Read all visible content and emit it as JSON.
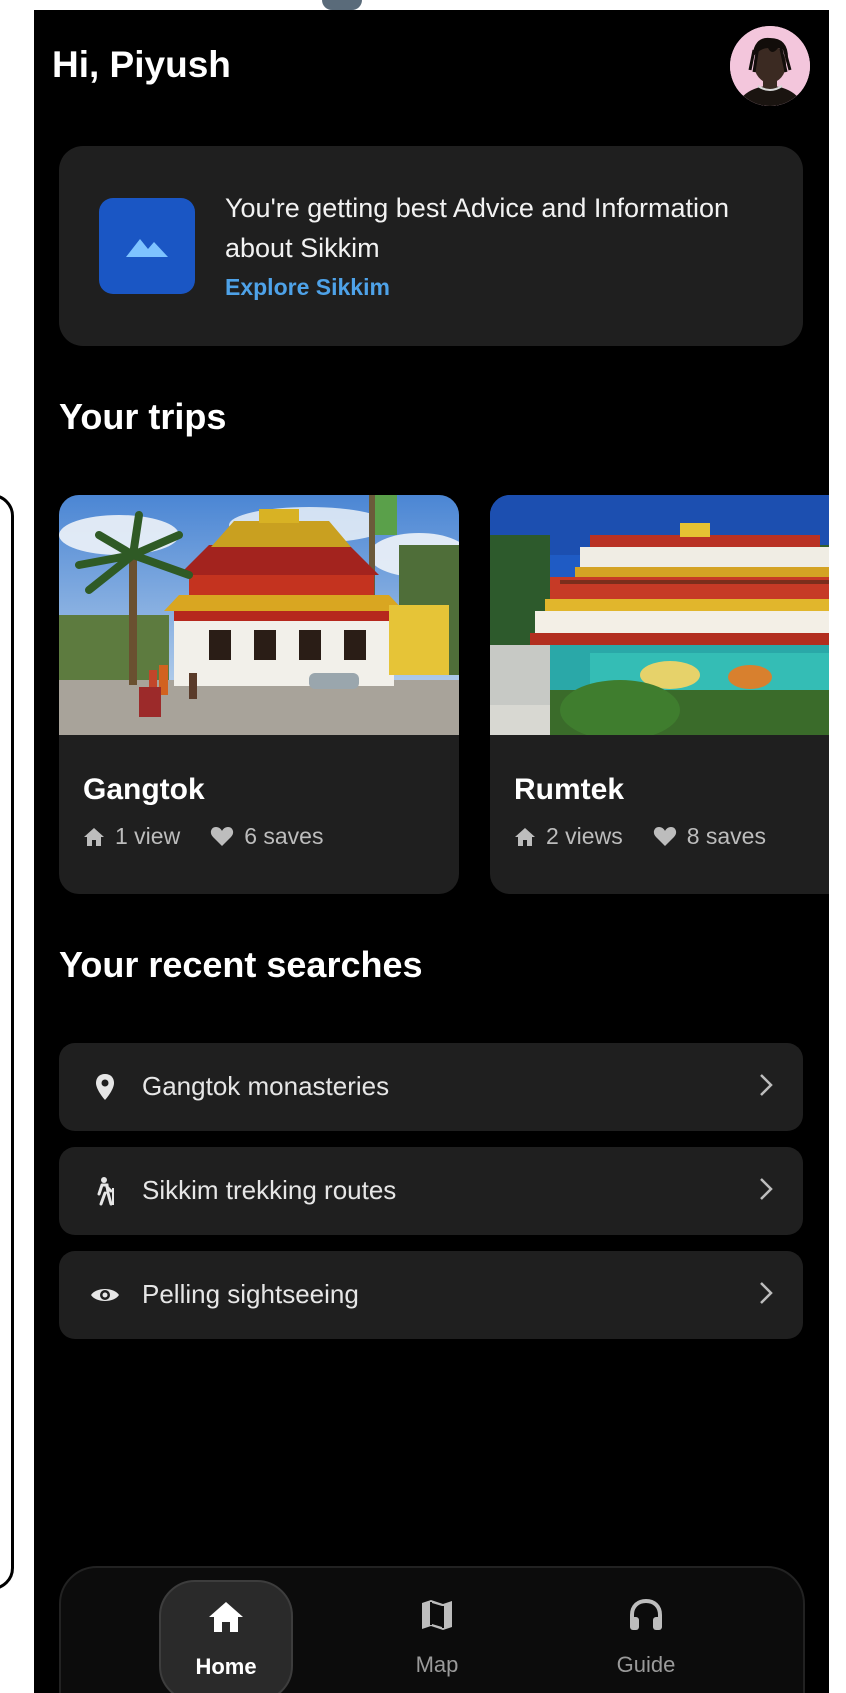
{
  "header": {
    "greeting": "Hi, Piyush"
  },
  "info_card": {
    "message": "You're getting best Advice and Information about Sikkim",
    "link": "Explore Sikkim",
    "icon": "landscape-icon",
    "accent": "#1a56c4",
    "link_color": "#4ea2e8"
  },
  "trips": {
    "heading": "Your trips",
    "items": [
      {
        "title": "Gangtok",
        "views": "1 view",
        "saves": "6 saves"
      },
      {
        "title": "Rumtek",
        "views": "2 views",
        "saves": "8 saves"
      }
    ]
  },
  "recent_searches": {
    "heading": "Your recent searches",
    "items": [
      {
        "icon": "location-pin-icon",
        "label": "Gangtok monasteries"
      },
      {
        "icon": "hiking-icon",
        "label": "Sikkim trekking routes"
      },
      {
        "icon": "eye-icon",
        "label": "Pelling sightseeing"
      }
    ]
  },
  "bottom_nav": {
    "active": "Home",
    "items": [
      {
        "icon": "home-icon",
        "label": "Home"
      },
      {
        "icon": "map-icon",
        "label": "Map"
      },
      {
        "icon": "headphones-icon",
        "label": "Guide"
      }
    ]
  },
  "colors": {
    "background": "#000000",
    "card": "#1f1f1f",
    "text_primary": "#ffffff",
    "text_secondary": "#bdbdbd"
  }
}
